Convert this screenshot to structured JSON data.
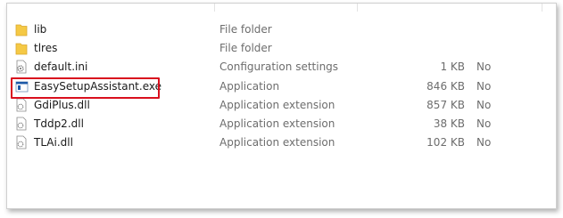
{
  "files": [
    {
      "name": "lib",
      "type": "File folder",
      "size": "",
      "compressed": "",
      "icon": "folder-icon"
    },
    {
      "name": "tlres",
      "type": "File folder",
      "size": "",
      "compressed": "",
      "icon": "folder-icon"
    },
    {
      "name": "default.ini",
      "type": "Configuration settings",
      "size": "1 KB",
      "compressed": "No",
      "icon": "settings-file-icon"
    },
    {
      "name": "EasySetupAssistant.exe",
      "type": "Application",
      "size": "846 KB",
      "compressed": "No",
      "icon": "application-icon"
    },
    {
      "name": "GdiPlus.dll",
      "type": "Application extension",
      "size": "857 KB",
      "compressed": "No",
      "icon": "dll-file-icon"
    },
    {
      "name": "Tddp2.dll",
      "type": "Application extension",
      "size": "38 KB",
      "compressed": "No",
      "icon": "dll-file-icon"
    },
    {
      "name": "TLAi.dll",
      "type": "Application extension",
      "size": "102 KB",
      "compressed": "No",
      "icon": "dll-file-icon"
    }
  ],
  "colors": {
    "highlight": "#d9101e",
    "folder": "#f5c945",
    "app_title_bar": "#1e5aa8"
  }
}
